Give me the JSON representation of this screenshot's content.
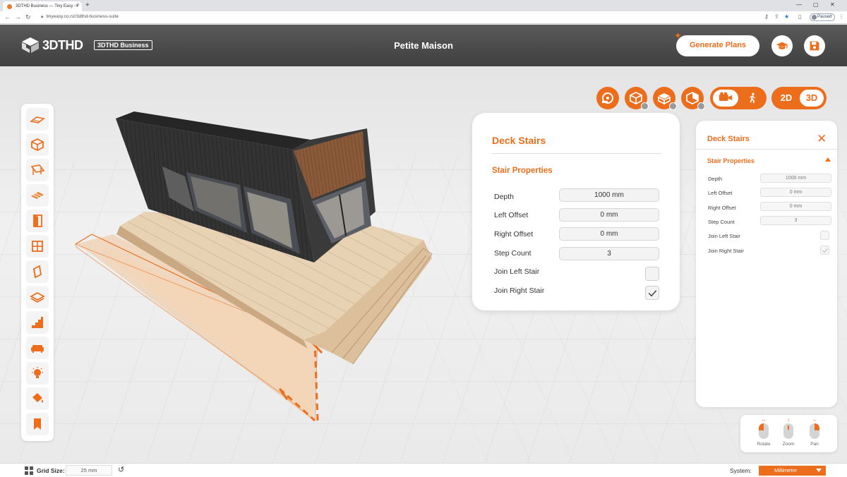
{
  "browser": {
    "tab_title": "3DTHD Business — Tiny Easy - F",
    "url": "tinyeasy.co.nz/3dthd-business-suite",
    "profile_status": "Paused"
  },
  "header": {
    "logo_text": "3DTHD",
    "business_badge": "3DTHD Business",
    "project_title": "Petite Maison",
    "generate_plans_label": "Generate Plans"
  },
  "view_toggle": {
    "mode_2d": "2D",
    "mode_3d": "3D",
    "active": "3D"
  },
  "left_tools": [
    {
      "name": "roof-tool",
      "icon": "roof-icon"
    },
    {
      "name": "cube-tool",
      "icon": "cube-icon"
    },
    {
      "name": "awning-tool",
      "icon": "awning-icon"
    },
    {
      "name": "deck-tool",
      "icon": "deck-icon"
    },
    {
      "name": "door-tool",
      "icon": "door-icon"
    },
    {
      "name": "window-tool",
      "icon": "window-icon"
    },
    {
      "name": "wall-panel-tool",
      "icon": "wall-panel-icon"
    },
    {
      "name": "floor-tool",
      "icon": "floor-layer-icon"
    },
    {
      "name": "stairs-tool",
      "icon": "stairs-icon"
    },
    {
      "name": "furniture-tool",
      "icon": "sofa-icon"
    },
    {
      "name": "lighting-tool",
      "icon": "lightbulb-icon"
    },
    {
      "name": "paint-tool",
      "icon": "paint-bucket-icon"
    },
    {
      "name": "bookmark-tool",
      "icon": "bookmark-icon"
    }
  ],
  "properties_panel": {
    "title": "Deck Stairs",
    "section": "Stair Properties",
    "fields": [
      {
        "label": "Depth",
        "value": "1000 mm"
      },
      {
        "label": "Left Offset",
        "value": "0 mm"
      },
      {
        "label": "Right Offset",
        "value": "0 mm"
      },
      {
        "label": "Step Count",
        "value": "3"
      }
    ],
    "checks": [
      {
        "label": "Join Left Stair",
        "checked": false
      },
      {
        "label": "Join Right Stair",
        "checked": true
      }
    ]
  },
  "side_panel": {
    "title": "Deck Stairs",
    "section": "Stair Properties",
    "fields": [
      {
        "label": "Depth",
        "value": "1000 mm"
      },
      {
        "label": "Left Offset",
        "value": "0 mm"
      },
      {
        "label": "Right Offset",
        "value": "0 mm"
      },
      {
        "label": "Step Count",
        "value": "3"
      }
    ],
    "checks": [
      {
        "label": "Join Left Stair",
        "checked": false
      },
      {
        "label": "Join Right Stair",
        "checked": true
      }
    ]
  },
  "mouse_help": {
    "rotate": "Rotate",
    "zoom": "Zoom",
    "pan": "Pan"
  },
  "bottom": {
    "grid_size_label": "Grid Size:",
    "grid_size_value": "25 mm",
    "system_label": "System:",
    "system_value": "Millimetre"
  },
  "colors": {
    "accent": "#ec6d1c",
    "header_bg": "#4a4a4a"
  }
}
